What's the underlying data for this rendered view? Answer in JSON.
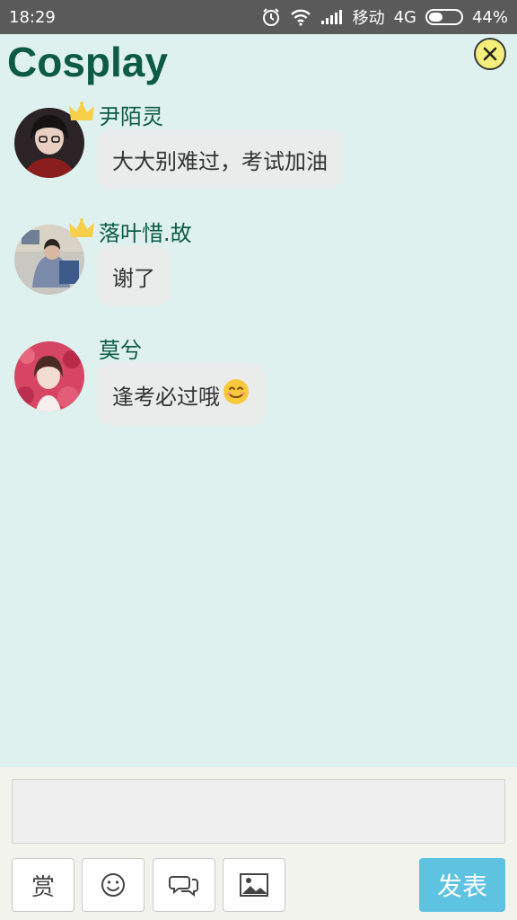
{
  "status_bar": {
    "time": "18:29",
    "carrier": "移动",
    "network": "4G",
    "battery": "44%",
    "battery_level": 0.44
  },
  "header": {
    "title": "Cosplay"
  },
  "messages": [
    {
      "name": "尹陌灵",
      "text": "大大别难过，考试加油",
      "crown": true,
      "avatar_color": "#8a1e1e"
    },
    {
      "name": "落叶惜.故",
      "text": "谢了",
      "crown": true,
      "avatar_color": "#7b8aa8"
    },
    {
      "name": "莫兮",
      "text": "逢考必过哦",
      "emoji": "smile-emoji",
      "crown": false,
      "avatar_color": "#d64563"
    }
  ],
  "composer": {
    "reward_label": "赏",
    "send_label": "发表",
    "send_color": "#5ec2e1"
  }
}
